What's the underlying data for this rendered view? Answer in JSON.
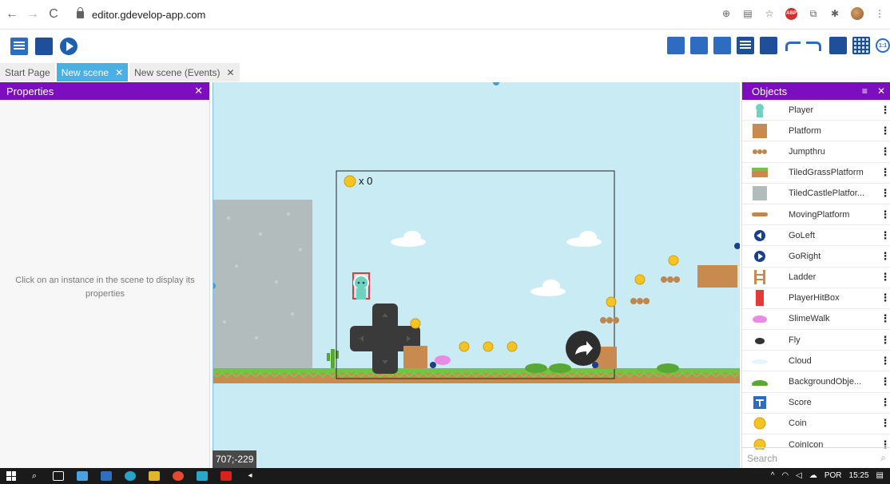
{
  "browser": {
    "url": "editor.gdevelop-app.com"
  },
  "tabs": [
    {
      "label": "Start Page"
    },
    {
      "label": "New scene"
    },
    {
      "label": "New scene (Events)"
    }
  ],
  "properties": {
    "title": "Properties",
    "empty_message": "Click on an instance in the scene to display its properties"
  },
  "scene": {
    "coords": "707;-229",
    "coin_counter": "x 0"
  },
  "objects": {
    "title": "Objects",
    "search_placeholder": "Search",
    "items": [
      {
        "name": "Player",
        "icon": "player-icon"
      },
      {
        "name": "Platform",
        "icon": "platform-icon"
      },
      {
        "name": "Jumpthru",
        "icon": "jumpthru-icon"
      },
      {
        "name": "TiledGrassPlatform",
        "icon": "grass-platform-icon"
      },
      {
        "name": "TiledCastlePlatfor...",
        "icon": "castle-platform-icon"
      },
      {
        "name": "MovingPlatform",
        "icon": "moving-platform-icon"
      },
      {
        "name": "GoLeft",
        "icon": "go-left-icon"
      },
      {
        "name": "GoRight",
        "icon": "go-right-icon"
      },
      {
        "name": "Ladder",
        "icon": "ladder-icon"
      },
      {
        "name": "PlayerHitBox",
        "icon": "hitbox-icon"
      },
      {
        "name": "SlimeWalk",
        "icon": "slime-icon"
      },
      {
        "name": "Fly",
        "icon": "fly-icon"
      },
      {
        "name": "Cloud",
        "icon": "cloud-icon"
      },
      {
        "name": "BackgroundObje...",
        "icon": "background-object-icon"
      },
      {
        "name": "Score",
        "icon": "score-icon"
      },
      {
        "name": "Coin",
        "icon": "coin-icon"
      },
      {
        "name": "CoinIcon",
        "icon": "coin-icon"
      }
    ]
  },
  "taskbar": {
    "language": "POR",
    "time": "15:25"
  },
  "colors": {
    "properties_header": "#7d0ec0",
    "active_tab": "#4ab0e4",
    "scene_background": "#c9ebf3",
    "toolbar_blue": "#2d6cc0"
  }
}
